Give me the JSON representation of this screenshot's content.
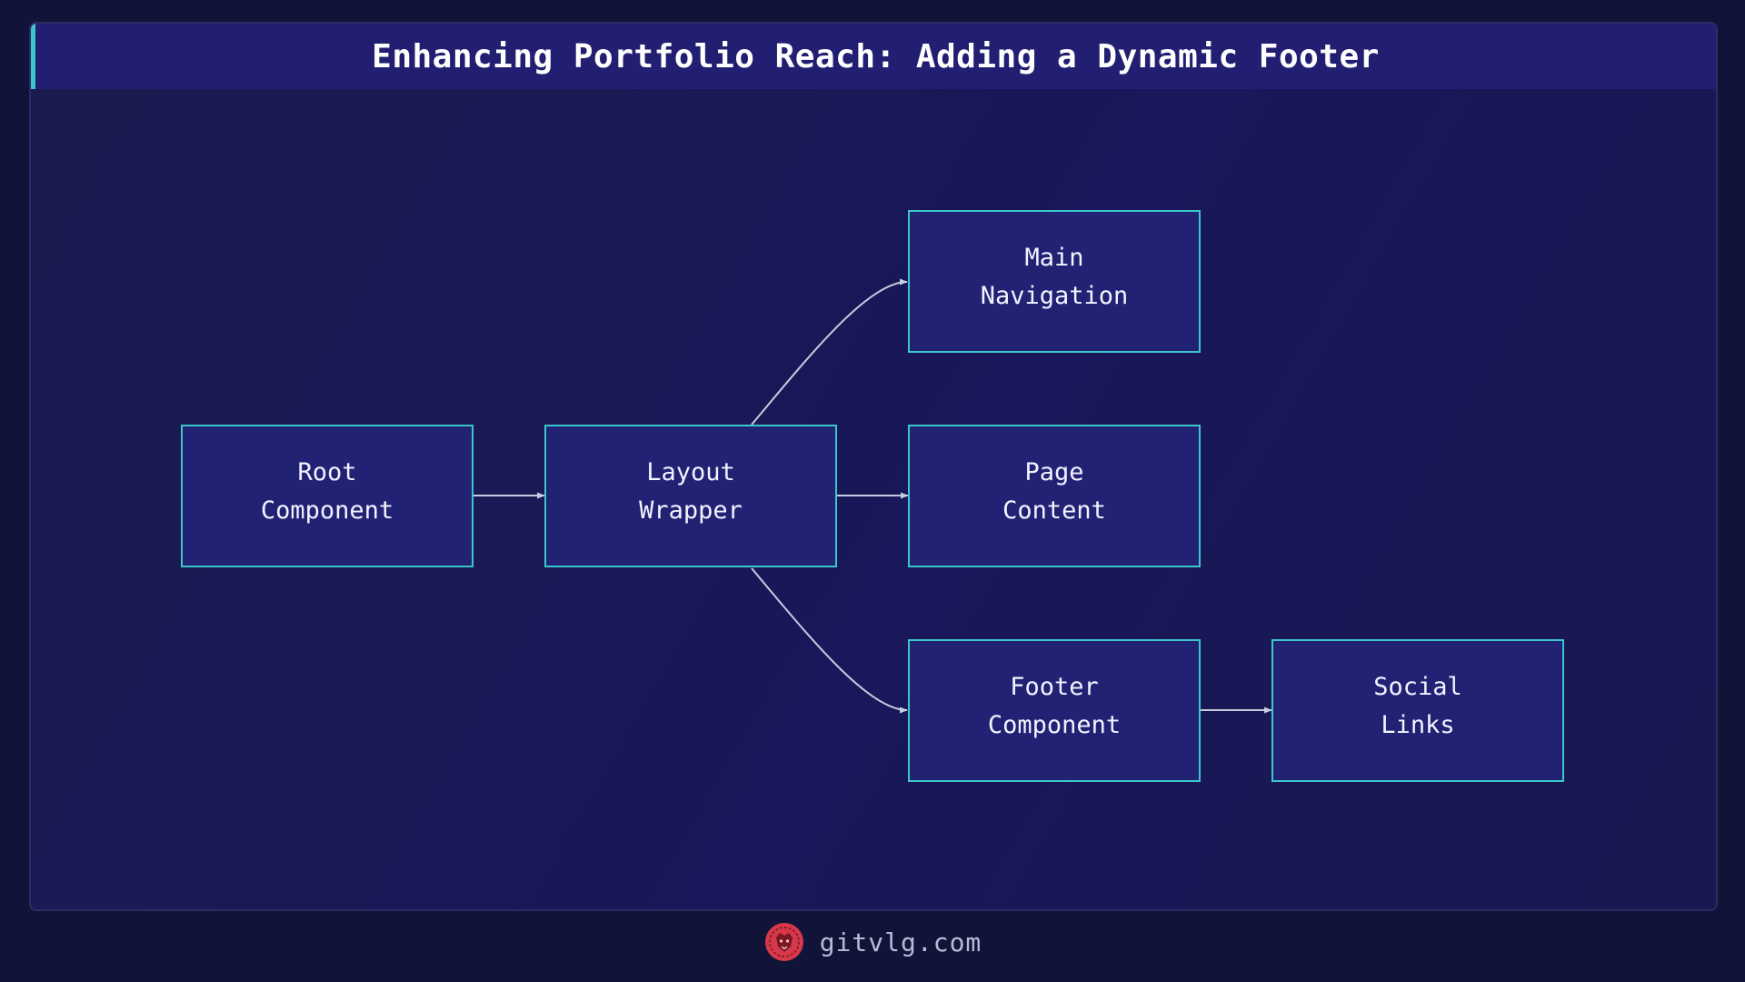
{
  "title": "Enhancing Portfolio Reach: Adding a Dynamic Footer",
  "nodes": {
    "root": {
      "line1": "Root",
      "line2": "Component"
    },
    "layout": {
      "line1": "Layout",
      "line2": "Wrapper"
    },
    "nav": {
      "line1": "Main",
      "line2": "Navigation"
    },
    "page": {
      "line1": "Page",
      "line2": "Content"
    },
    "footer": {
      "line1": "Footer",
      "line2": "Component"
    },
    "social": {
      "line1": "Social",
      "line2": "Links"
    }
  },
  "edges": [
    {
      "from": "Root Component",
      "to": "Layout Wrapper"
    },
    {
      "from": "Layout Wrapper",
      "to": "Main Navigation"
    },
    {
      "from": "Layout Wrapper",
      "to": "Page Content"
    },
    {
      "from": "Layout Wrapper",
      "to": "Footer Component"
    },
    {
      "from": "Footer Component",
      "to": "Social Links"
    }
  ],
  "footer": {
    "brand": "gitvlg.com",
    "logo_icon": "lion-logo-icon"
  },
  "colors": {
    "background": "#121339",
    "panel": "#1a1a52",
    "title_bar": "#221f72",
    "accent": "#3cc6c9",
    "node_fill": "#222275",
    "node_border": "#3cc6c9",
    "edge": "#c9cbe0",
    "logo": "#d8394a"
  }
}
